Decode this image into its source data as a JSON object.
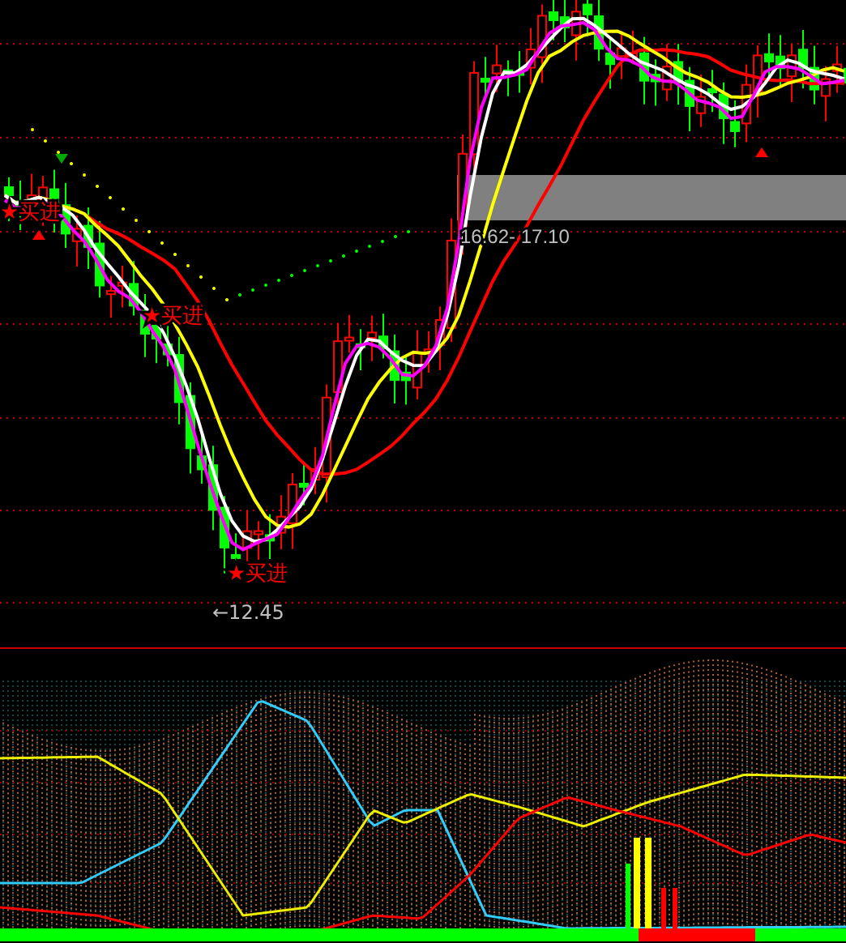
{
  "price_chart": {
    "buy_signals": [
      {
        "label": "★买进"
      },
      {
        "label": "★买进"
      },
      {
        "label": "★买进"
      }
    ],
    "range_band": {
      "label": "16.62- 17.10"
    },
    "low_marker": {
      "label": "←12.45"
    }
  }
}
